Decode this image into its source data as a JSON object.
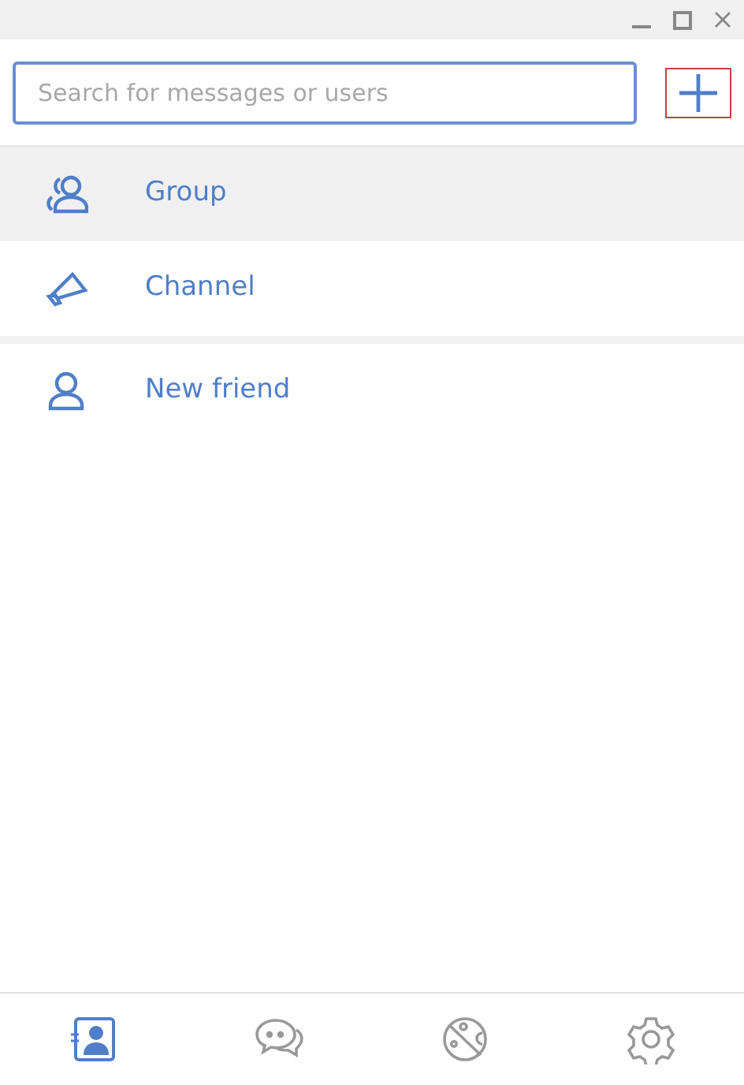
{
  "search": {
    "placeholder": "Search for messages or users"
  },
  "sections": [
    {
      "items": [
        {
          "kind": "group",
          "label": "Group",
          "selected": true
        },
        {
          "kind": "channel",
          "label": "Channel",
          "selected": false
        }
      ]
    },
    {
      "items": [
        {
          "kind": "friend",
          "label": "New friend",
          "selected": false
        }
      ]
    }
  ],
  "tabs": [
    {
      "kind": "contacts",
      "selected": true
    },
    {
      "kind": "chats",
      "selected": false
    },
    {
      "kind": "explore",
      "selected": false
    },
    {
      "kind": "settings",
      "selected": false
    }
  ]
}
